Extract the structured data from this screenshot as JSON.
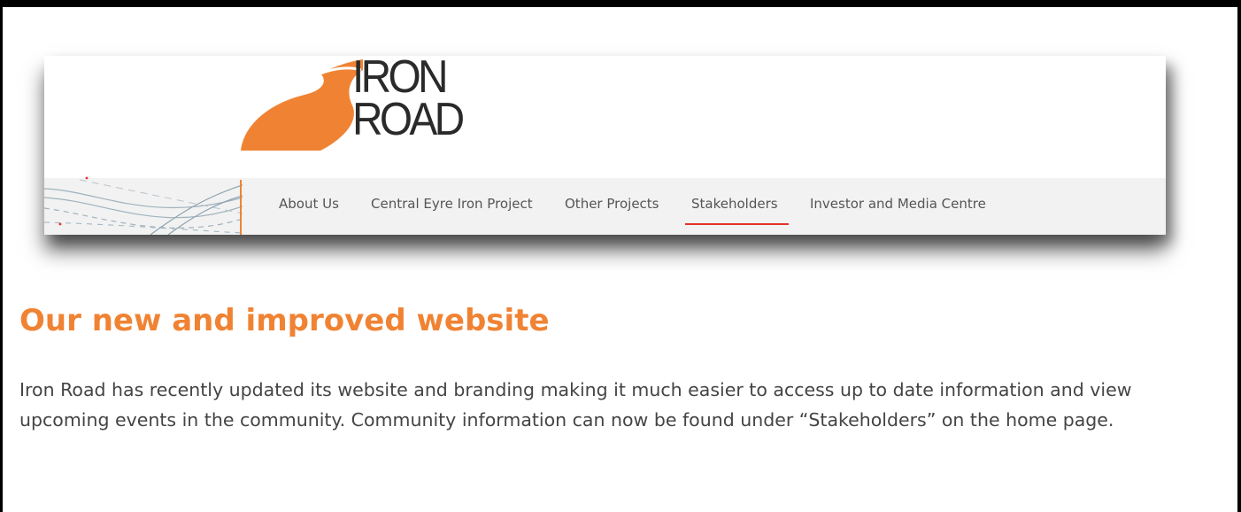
{
  "logo": {
    "line1": "IRON",
    "line2": "ROAD",
    "accent_color": "#f08333"
  },
  "nav": {
    "items": [
      {
        "label": "About Us"
      },
      {
        "label": "Central Eyre Iron Project"
      },
      {
        "label": "Other Projects"
      },
      {
        "label": "Stakeholders",
        "active": true
      },
      {
        "label": "Investor and Media Centre"
      }
    ],
    "active_color": "#e4312b"
  },
  "article": {
    "headline": "Our new and improved website",
    "body": "Iron Road has recently updated its website and branding making it much easier to access up to date information and view upcoming events in the community. Community information can now be found under “Stakeholders” on the home page.",
    "headline_color": "#f08333"
  }
}
